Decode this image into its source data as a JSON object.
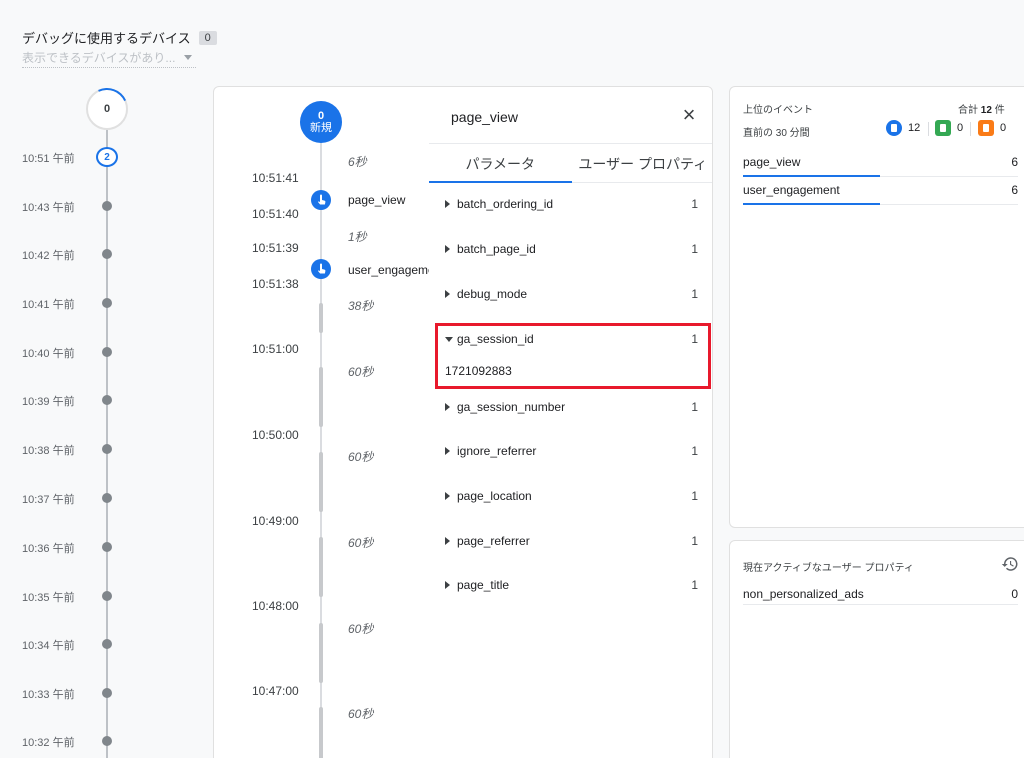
{
  "device": {
    "title": "デバッグに使用するデバイス",
    "count": "0",
    "select_placeholder": "表示できるデバイスがあり..."
  },
  "minutes": {
    "top_count": "0",
    "rows": [
      {
        "label": "10:51 午前",
        "badge": "2"
      },
      {
        "label": "10:43 午前"
      },
      {
        "label": "10:42 午前"
      },
      {
        "label": "10:41 午前"
      },
      {
        "label": "10:40 午前"
      },
      {
        "label": "10:39 午前"
      },
      {
        "label": "10:38 午前"
      },
      {
        "label": "10:37 午前"
      },
      {
        "label": "10:36 午前"
      },
      {
        "label": "10:35 午前"
      },
      {
        "label": "10:34 午前"
      },
      {
        "label": "10:33 午前"
      },
      {
        "label": "10:32 午前"
      }
    ]
  },
  "stream": {
    "top_count": "0",
    "top_label": "新規",
    "timestamps": [
      "10:51:41",
      "10:51:40",
      "10:51:39",
      "10:51:38",
      "10:51:00",
      "10:50:00",
      "10:49:00",
      "10:48:00",
      "10:47:00"
    ],
    "durations": [
      "6秒",
      "1秒",
      "38秒",
      "60秒",
      "60秒",
      "60秒",
      "60秒",
      "60秒"
    ],
    "events": [
      "page_view",
      "user_engagement"
    ]
  },
  "detail": {
    "title": "page_view",
    "close_icon": "×",
    "tabs": [
      "パラメータ",
      "ユーザー プロパティ"
    ],
    "params": [
      {
        "name": "batch_ordering_id",
        "count": "1"
      },
      {
        "name": "batch_page_id",
        "count": "1"
      },
      {
        "name": "debug_mode",
        "count": "1"
      },
      {
        "name": "ga_session_id",
        "count": "1",
        "value": "1721092883"
      },
      {
        "name": "ga_session_number",
        "count": "1"
      },
      {
        "name": "ignore_referrer",
        "count": "1"
      },
      {
        "name": "page_location",
        "count": "1"
      },
      {
        "name": "page_referrer",
        "count": "1"
      },
      {
        "name": "page_title",
        "count": "1"
      }
    ]
  },
  "top_events": {
    "title": "上位のイベント",
    "total_prefix": "合計",
    "total_value": "12",
    "total_suffix": "件",
    "range": "直前の 30 分間",
    "stats": {
      "blue": "12",
      "green": "0",
      "orange": "0"
    },
    "events": [
      {
        "name": "page_view",
        "count": "6"
      },
      {
        "name": "user_engagement",
        "count": "6"
      }
    ]
  },
  "user_props": {
    "title": "現在アクティブなユーザー プロパティ",
    "rows": [
      {
        "name": "non_personalized_ads",
        "value": "0"
      }
    ]
  },
  "colors": {
    "accent": "#1a73e8",
    "highlight": "#e8192c",
    "green": "#34a853",
    "orange": "#fa7b17"
  }
}
